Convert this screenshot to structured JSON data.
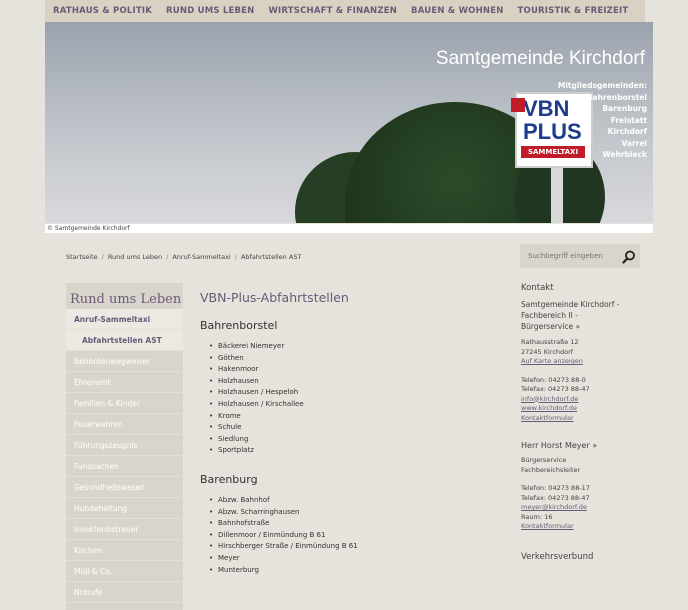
{
  "topnav": [
    "RATHAUS & POLITIK",
    "RUND UMS LEBEN",
    "WIRTSCHAFT & FINANZEN",
    "BAUEN & WOHNEN",
    "TOURISTIK & FREIZEIT"
  ],
  "banner": {
    "title": "Samtgemeinde Kirchdorf",
    "municipalities": [
      "Mitgliedsgemeinden:",
      "Bahrenborstel",
      "Barenburg",
      "Freistatt",
      "Kirchdorf",
      "Varrel",
      "Wehrbleck"
    ],
    "sign_line1": "VBN",
    "sign_line2": "PLUS",
    "sign_line3": "SAMMELTAXI",
    "copyright": "© Samtgemeinde Kirchdorf"
  },
  "breadcrumb": [
    "Startseite",
    "Rund ums Leben",
    "Anruf-Sammeltaxi",
    "Abfahrtstellen AST"
  ],
  "search": {
    "placeholder": "Suchbegriff eingeben"
  },
  "sidebar": {
    "heading": "Rund ums Leben",
    "items": [
      "Anruf-Sammeltaxi",
      "Abfahrtstellen AST",
      "Behördenwegweiser",
      "Ehrenamt",
      "Familien & Kinder",
      "Feuerwehren",
      "Führungszeugnis",
      "Fundsachen",
      "Gesundheitswesen",
      "Hundehaltung",
      "Insektenbetreuer",
      "Kirchen",
      "Müll & Co.",
      "Notrufe"
    ]
  },
  "main": {
    "title": "VBN-Plus-Abfahrtstellen",
    "sections": [
      {
        "heading": "Bahrenborstel",
        "stops": [
          "Bäckerei Niemeyer",
          "Göthen",
          "Hakenmoor",
          "Holzhausen",
          "Holzhausen / Hespeloh",
          "Holzhausen / Kirschallee",
          "Krome",
          "Schule",
          "Siedlung",
          "Sportplatz"
        ]
      },
      {
        "heading": "Barenburg",
        "stops": [
          "Abzw. Bahnhof",
          "Abzw. Scharringhausen",
          "Bahnhofstraße",
          "Dillenmoor / Einmündung B 61",
          "Hirschberger Straße / Einmündung B 61",
          "Meyer",
          "Munterburg"
        ]
      }
    ]
  },
  "right": {
    "kontakt_heading": "Kontakt",
    "org_line1": "Samtgemeinde Kirchdorf -",
    "org_line2": "Fachbereich II -",
    "org_line3": "Bürgerservice »",
    "street": "Rathausstraße 12",
    "city": "27245 Kirchdorf",
    "map_link": "Auf Karte anzeigen",
    "phone": "Telefon: 04273 88-0",
    "fax": "Telefax: 04273 88-47",
    "email": "info@kirchdorf.de",
    "web": "www.kirchdorf.de",
    "form": "Kontaktformular",
    "person": "Herr Horst Meyer »",
    "role1": "Bürgerservice",
    "role2": "Fachbereichsleiter",
    "p_phone": "Telefon: 04273 88-17",
    "p_fax": "Telefax: 04273 88-47",
    "p_email": "meyer@kirchdorf.de",
    "p_room": "Raum: 16",
    "p_form": "Kontaktformular",
    "verbund": "Verkehrsverbund"
  }
}
